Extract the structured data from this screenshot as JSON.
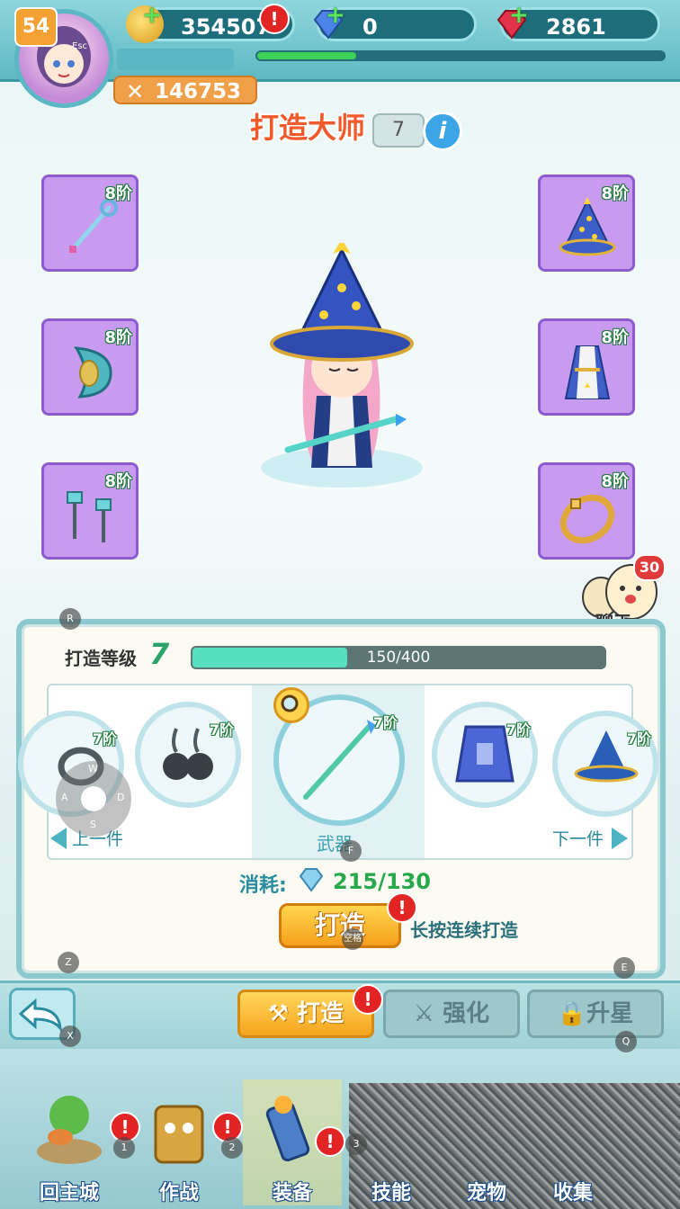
{
  "player": {
    "level": "54",
    "esc_hint": "Esc",
    "combat_power": "146753"
  },
  "resources": {
    "gold": "354507",
    "diamond": "0",
    "ruby": "2861"
  },
  "header": {
    "title": "打造大师",
    "master_level": "7",
    "info": "i"
  },
  "equipment_slots": [
    {
      "id": "staff",
      "tier": "8阶",
      "icon": "staff-icon"
    },
    {
      "id": "hat",
      "tier": "8阶",
      "icon": "wizard-hat-icon"
    },
    {
      "id": "shield",
      "tier": "8阶",
      "icon": "shield-icon"
    },
    {
      "id": "robe",
      "tier": "8阶",
      "icon": "robe-icon"
    },
    {
      "id": "earrings",
      "tier": "8阶",
      "icon": "earrings-icon"
    },
    {
      "id": "bracelet",
      "tier": "8阶",
      "icon": "bracelet-icon"
    }
  ],
  "chat": {
    "count": "30",
    "label": "聊天"
  },
  "forge_panel": {
    "level_label": "打造等级",
    "level": "7",
    "progress_text": "150/400",
    "progress_fraction": 0.375,
    "prev_label": "上一件",
    "next_label": "下一件",
    "selected_type": "武器",
    "carousel": [
      {
        "tier": "7阶",
        "icon": "ring-icon"
      },
      {
        "tier": "7阶",
        "icon": "earrings-icon"
      },
      {
        "tier": "7阶",
        "icon": "staff-icon"
      },
      {
        "tier": "7阶",
        "icon": "robe-icon"
      },
      {
        "tier": "7阶",
        "icon": "wizard-hat-icon"
      }
    ],
    "cost_label": "消耗:",
    "cost_value": "215/130",
    "forge_button": "打造",
    "hold_text": "长按连续打造"
  },
  "action_tabs": {
    "forge": "打造",
    "enhance": "强化",
    "star_up": "升星"
  },
  "bottom_nav": {
    "home": "回主城",
    "battle": "作战",
    "equipment": "装备",
    "skills": "技能",
    "pets": "宠物",
    "collect": "收集"
  },
  "key_hints": {
    "r": "R",
    "w": "W",
    "a": "A",
    "s": "S",
    "d": "D",
    "f": "F",
    "z": "Z",
    "e": "E",
    "x": "X",
    "q": "Q",
    "space": "空格",
    "k1": "1",
    "k2": "2",
    "k3": "3"
  },
  "colors": {
    "accent_teal": "#5fb9c3",
    "slot_purple": "#c89bf0",
    "progress_green": "#57e0c0",
    "button_orange": "#f6a01c"
  }
}
